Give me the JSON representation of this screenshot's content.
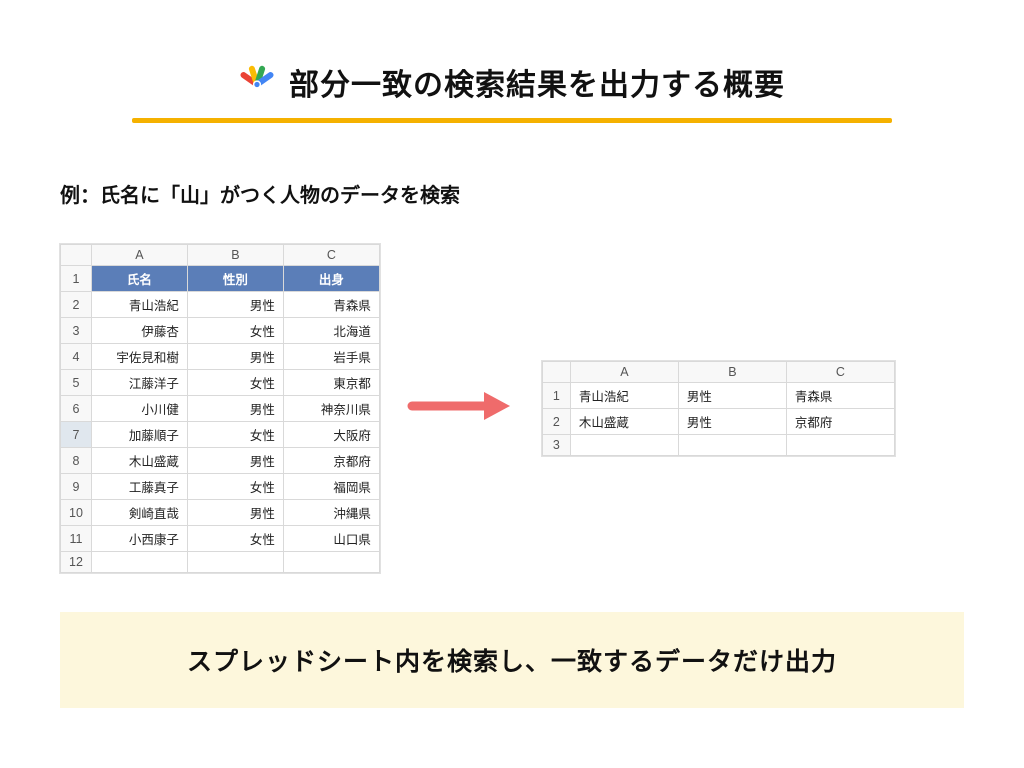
{
  "title": "部分一致の検索結果を出力する概要",
  "subtitle": "例：氏名に「山」がつく人物のデータを検索",
  "icon_name": "google-apps-script-icon",
  "left_table": {
    "col_labels": [
      "A",
      "B",
      "C"
    ],
    "header_row": [
      "氏名",
      "性別",
      "出身"
    ],
    "rows": [
      {
        "n": "2",
        "a": "青山浩紀",
        "b": "男性",
        "c": "青森県"
      },
      {
        "n": "3",
        "a": "伊藤杏",
        "b": "女性",
        "c": "北海道"
      },
      {
        "n": "4",
        "a": "宇佐見和樹",
        "b": "男性",
        "c": "岩手県"
      },
      {
        "n": "5",
        "a": "江藤洋子",
        "b": "女性",
        "c": "東京都"
      },
      {
        "n": "6",
        "a": "小川健",
        "b": "男性",
        "c": "神奈川県"
      },
      {
        "n": "7",
        "a": "加藤順子",
        "b": "女性",
        "c": "大阪府",
        "selected": true
      },
      {
        "n": "8",
        "a": "木山盛蔵",
        "b": "男性",
        "c": "京都府"
      },
      {
        "n": "9",
        "a": "工藤真子",
        "b": "女性",
        "c": "福岡県"
      },
      {
        "n": "10",
        "a": "剣崎直哉",
        "b": "男性",
        "c": "沖縄県"
      },
      {
        "n": "11",
        "a": "小西康子",
        "b": "女性",
        "c": "山口県"
      }
    ],
    "extra_row": "12"
  },
  "right_table": {
    "col_labels": [
      "A",
      "B",
      "C"
    ],
    "rows": [
      {
        "n": "1",
        "a": "青山浩紀",
        "b": "男性",
        "c": "青森県"
      },
      {
        "n": "2",
        "a": "木山盛蔵",
        "b": "男性",
        "c": "京都府"
      },
      {
        "n": "3",
        "a": "",
        "b": "",
        "c": ""
      }
    ]
  },
  "banner": "スプレッドシート内を検索し、一致するデータだけ出力",
  "chart_data": {
    "type": "table",
    "title": "部分一致の検索結果を出力する概要",
    "source_table": {
      "columns": [
        "氏名",
        "性別",
        "出身"
      ],
      "rows": [
        [
          "青山浩紀",
          "男性",
          "青森県"
        ],
        [
          "伊藤杏",
          "女性",
          "北海道"
        ],
        [
          "宇佐見和樹",
          "男性",
          "岩手県"
        ],
        [
          "江藤洋子",
          "女性",
          "東京都"
        ],
        [
          "小川健",
          "男性",
          "神奈川県"
        ],
        [
          "加藤順子",
          "女性",
          "大阪府"
        ],
        [
          "木山盛蔵",
          "男性",
          "京都府"
        ],
        [
          "工藤真子",
          "女性",
          "福岡県"
        ],
        [
          "剣崎直哉",
          "男性",
          "沖縄県"
        ],
        [
          "小西康子",
          "女性",
          "山口県"
        ]
      ]
    },
    "result_table": {
      "rows": [
        [
          "青山浩紀",
          "男性",
          "青森県"
        ],
        [
          "木山盛蔵",
          "男性",
          "京都府"
        ]
      ]
    }
  }
}
